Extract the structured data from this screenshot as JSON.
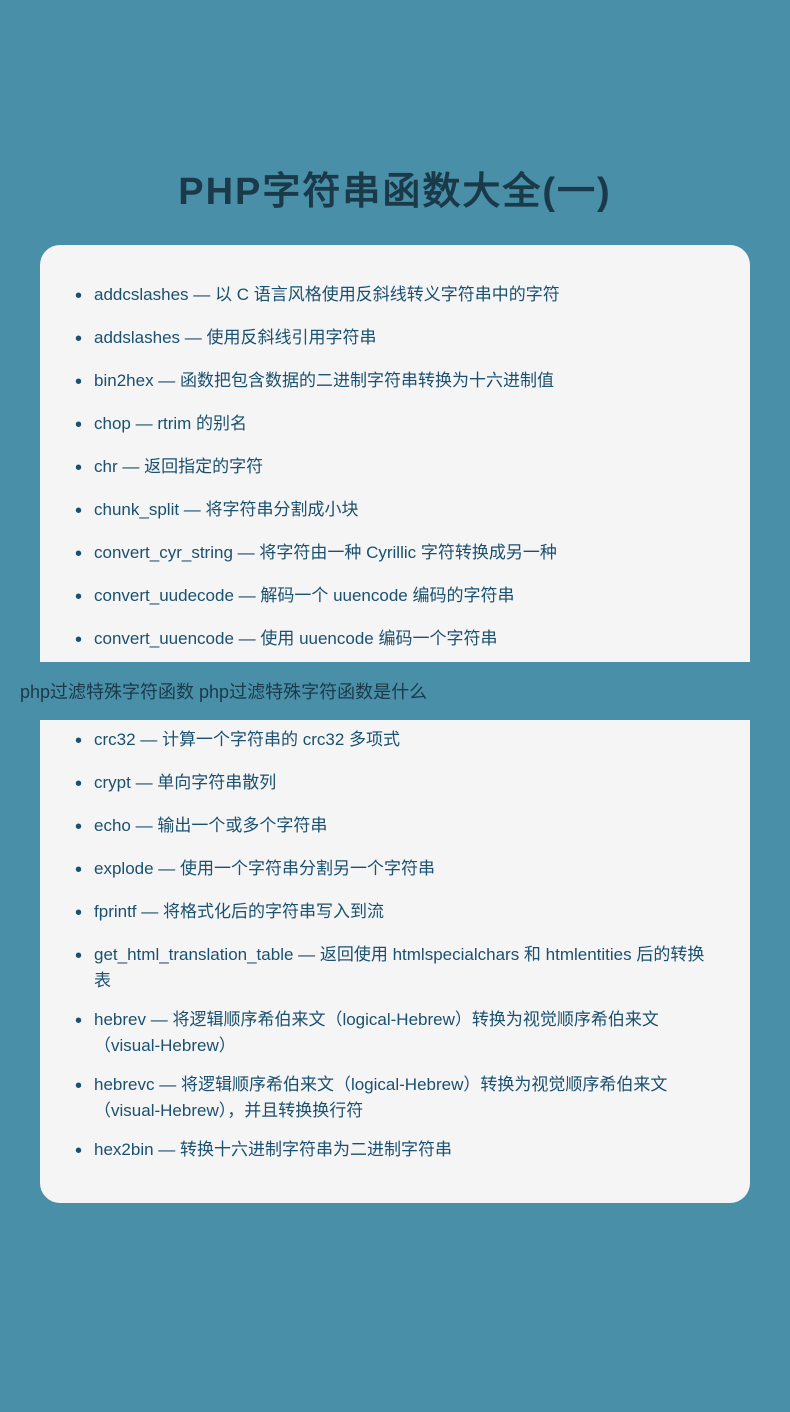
{
  "page": {
    "title": "PHP字符串函数大全(一)",
    "background_color": "#4a8fa8"
  },
  "search_bar": {
    "text": "php过滤特殊字符函数 php过滤特殊字符函数是什么"
  },
  "items_top": [
    {
      "name": "addcslashes",
      "description": "addcslashes — 以 C 语言风格使用反斜线转义字符串中的字符"
    },
    {
      "name": "addslashes",
      "description": "addslashes — 使用反斜线引用字符串"
    },
    {
      "name": "bin2hex",
      "description": "bin2hex — 函数把包含数据的二进制字符串转换为十六进制值"
    },
    {
      "name": "chop",
      "description": "chop — rtrim 的别名"
    },
    {
      "name": "chr",
      "description": "chr — 返回指定的字符"
    },
    {
      "name": "chunk_split",
      "description": "chunk_split — 将字符串分割成小块"
    },
    {
      "name": "convert_cyr_string",
      "description": "convert_cyr_string — 将字符由一种 Cyrillic 字符转换成另一种"
    },
    {
      "name": "convert_uudecode",
      "description": "convert_uudecode — 解码一个 uuencode 编码的字符串"
    },
    {
      "name": "convert_uuencode",
      "description": "convert_uuencode — 使用 uuencode 编码一个字符串"
    }
  ],
  "items_bottom": [
    {
      "name": "crc32",
      "description": "crc32 — 计算一个字符串的 crc32 多项式"
    },
    {
      "name": "crypt",
      "description": "crypt — 单向字符串散列"
    },
    {
      "name": "echo",
      "description": "echo — 输出一个或多个字符串"
    },
    {
      "name": "explode",
      "description": "explode — 使用一个字符串分割另一个字符串"
    },
    {
      "name": "fprintf",
      "description": "fprintf — 将格式化后的字符串写入到流"
    },
    {
      "name": "get_html_translation_table",
      "description": "get_html_translation_table — 返回使用 htmlspecialchars 和 htmlentities 后的转换表"
    },
    {
      "name": "hebrev",
      "description": "hebrev — 将逻辑顺序希伯来文（logical-Hebrew）转换为视觉顺序希伯来文（visual-Hebrew）"
    },
    {
      "name": "hebrevc",
      "description": "hebrevc — 将逻辑顺序希伯来文（logical-Hebrew）转换为视觉顺序希伯来文（visual-Hebrew），并且转换换行符"
    },
    {
      "name": "hex2bin",
      "description": "hex2bin — 转换十六进制字符串为二进制字符串"
    }
  ],
  "bullet": "•"
}
